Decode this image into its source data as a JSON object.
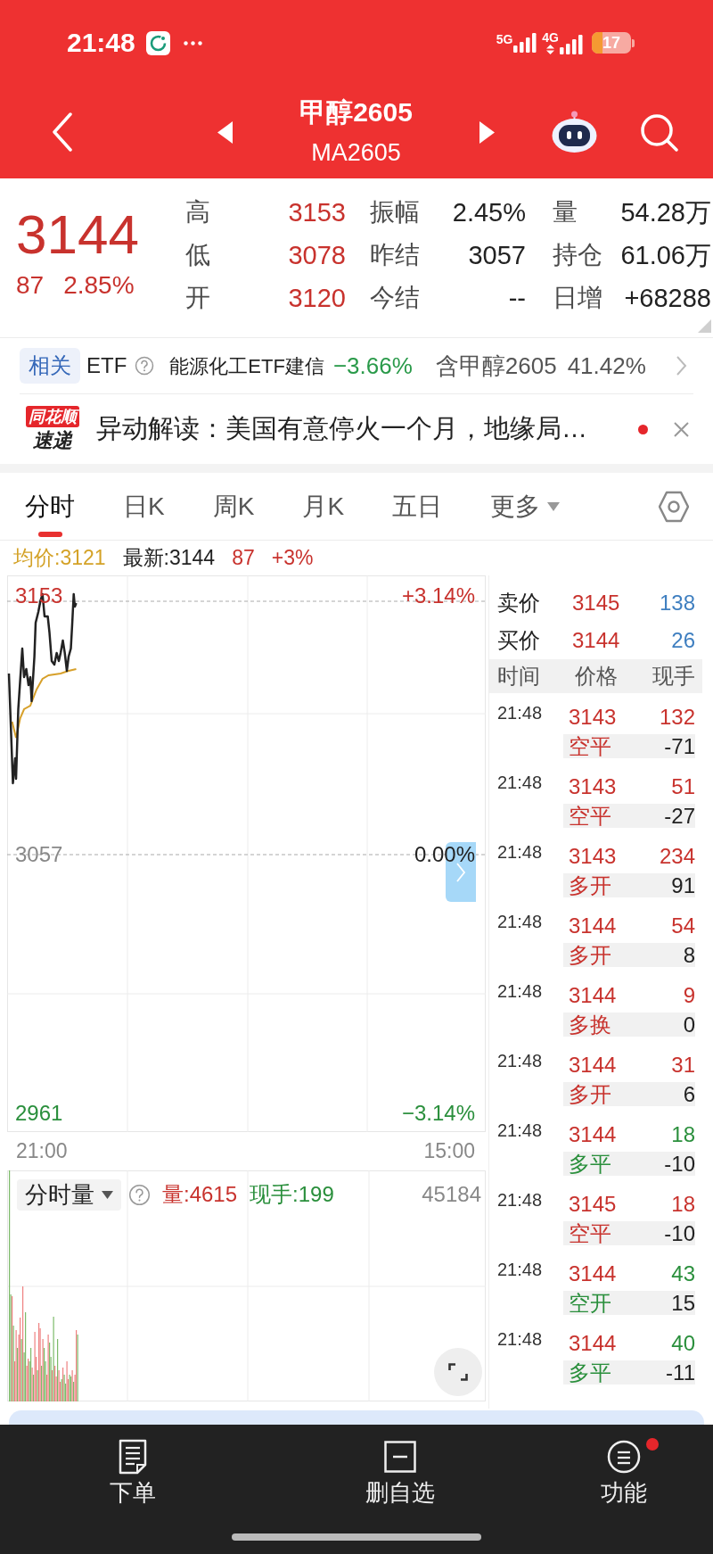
{
  "status_bar": {
    "time": "21:48",
    "network_1": "5G",
    "network_2": "4G",
    "battery": "17"
  },
  "header": {
    "title": "甲醇2605",
    "code": "MA2605"
  },
  "quote": {
    "price": "3144",
    "change": "87",
    "change_percent": "2.85%",
    "stats": [
      [
        {
          "label": "高",
          "value": "3153",
          "color": "#c8322d"
        },
        {
          "label": "振幅",
          "value": "2.45%",
          "color": "#222222"
        },
        {
          "label": "量",
          "value": "54.28万",
          "color": "#222222"
        }
      ],
      [
        {
          "label": "低",
          "value": "3078",
          "color": "#c8322d"
        },
        {
          "label": "昨结",
          "value": "3057",
          "color": "#222222"
        },
        {
          "label": "持仓",
          "value": "61.06万",
          "color": "#222222"
        }
      ],
      [
        {
          "label": "开",
          "value": "3120",
          "color": "#c8322d"
        },
        {
          "label": "今结",
          "value": "--",
          "color": "#222222"
        },
        {
          "label": "日增",
          "value": "+68288",
          "color": "#222222"
        }
      ]
    ]
  },
  "related_etf": {
    "badge": "相关",
    "label": "ETF",
    "fund": "能源化工ETF建信",
    "fund_change": "−3.66%",
    "holding": "含甲醇2605",
    "holding_weight": "41.42%"
  },
  "news": {
    "logo_top": "同花顺",
    "logo_bottom": "速递",
    "headline": "异动解读：美国有意停火一个月，地缘局…",
    "unread": true
  },
  "tabs": [
    {
      "label": "分时",
      "selected": true,
      "kind": "tab"
    },
    {
      "label": "日K",
      "selected": false,
      "kind": "tab"
    },
    {
      "label": "周K",
      "selected": false,
      "kind": "tab"
    },
    {
      "label": "月K",
      "selected": false,
      "kind": "tab"
    },
    {
      "label": "五日",
      "selected": false,
      "kind": "tab"
    },
    {
      "label": "更多",
      "selected": false,
      "kind": "menu"
    }
  ],
  "summary": {
    "average": "均价:3121",
    "latest": "最新:3144",
    "change": "87",
    "change_percent": "+3%"
  },
  "price_chart": {
    "left_labels": [
      {
        "text": "3153",
        "color": "#c8322d"
      },
      {
        "text": "3057",
        "color": "#888888"
      },
      {
        "text": "2961",
        "color": "#2a8f3c"
      }
    ],
    "right_labels": [
      {
        "text": "+3.14%",
        "color": "#c8322d"
      },
      {
        "text": "0.00%",
        "color": "#222222"
      },
      {
        "text": "−3.14%",
        "color": "#2a8f3c"
      }
    ],
    "time_labels": [
      "21:00",
      "15:00"
    ]
  },
  "volume_chart": {
    "selector": "分时量",
    "volume": "量:4615",
    "current": "现手:199",
    "max": "45184"
  },
  "order_book": [
    {
      "label": "卖价",
      "price": "3145",
      "quantity": "138"
    },
    {
      "label": "买价",
      "price": "3144",
      "quantity": "26"
    }
  ],
  "trades": {
    "columns": [
      "时间",
      "价格",
      "现手"
    ],
    "rows": [
      {
        "time": "21:48",
        "price": "3143",
        "volume": "132",
        "type": "空平",
        "change": "-71",
        "color": "#c8322d"
      },
      {
        "time": "21:48",
        "price": "3143",
        "volume": "51",
        "type": "空平",
        "change": "-27",
        "color": "#c8322d"
      },
      {
        "time": "21:48",
        "price": "3143",
        "volume": "234",
        "type": "多开",
        "change": "91",
        "color": "#c8322d"
      },
      {
        "time": "21:48",
        "price": "3144",
        "volume": "54",
        "type": "多开",
        "change": "8",
        "color": "#c8322d"
      },
      {
        "time": "21:48",
        "price": "3144",
        "volume": "9",
        "type": "多换",
        "change": "0",
        "color": "#c8322d"
      },
      {
        "time": "21:48",
        "price": "3144",
        "volume": "31",
        "type": "多开",
        "change": "6",
        "color": "#c8322d"
      },
      {
        "time": "21:48",
        "price": "3144",
        "volume": "18",
        "type": "多平",
        "change": "-10",
        "color": "#2a8f3c"
      },
      {
        "time": "21:48",
        "price": "3145",
        "volume": "18",
        "type": "空平",
        "change": "-10",
        "color": "#c8322d"
      },
      {
        "time": "21:48",
        "price": "3144",
        "volume": "43",
        "type": "空开",
        "change": "15",
        "color": "#2a8f3c"
      },
      {
        "time": "21:48",
        "price": "3144",
        "volume": "40",
        "type": "多平",
        "change": "-11",
        "color": "#2a8f3c"
      }
    ]
  },
  "bottom_nav": [
    {
      "label": "下单",
      "badge": false
    },
    {
      "label": "删自选",
      "badge": false
    },
    {
      "label": "功能",
      "badge": true
    }
  ]
}
